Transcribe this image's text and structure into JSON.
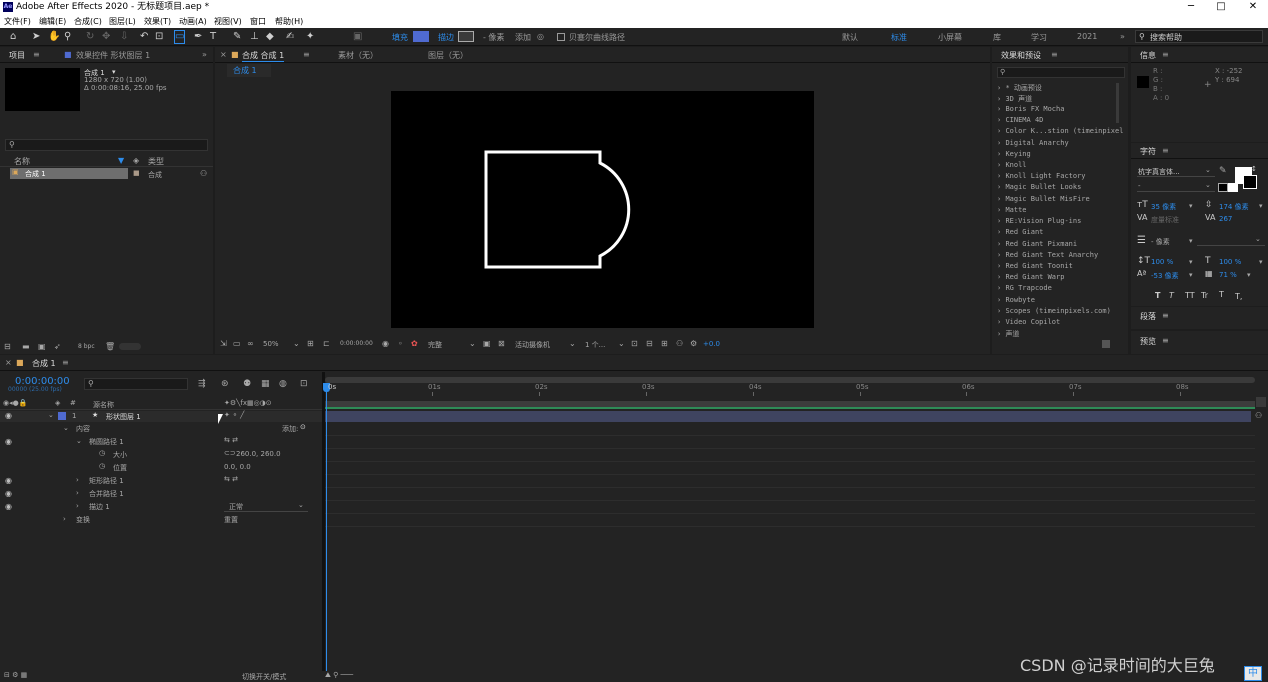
{
  "app": {
    "title": "Adobe After Effects 2020 - 无标题项目.aep *",
    "logo": "Ae"
  },
  "window_controls": {
    "min": "─",
    "max": "□",
    "close": "✕"
  },
  "menu": [
    "文件(F)",
    "编辑(E)",
    "合成(C)",
    "图层(L)",
    "效果(T)",
    "动画(A)",
    "视图(V)",
    "窗口",
    "帮助(H)"
  ],
  "toolbar": {
    "fill_label": "填充",
    "stroke_label": "描边",
    "stroke_px": "- 像素",
    "add_label": "添加",
    "bezier_label": "贝塞尔曲线路径",
    "workspaces": [
      "默认",
      "标准",
      "小屏幕",
      "库",
      "学习",
      "2021"
    ],
    "active_workspace": "标准",
    "search_help": "搜索帮助"
  },
  "project_panel": {
    "tab": "项目",
    "tab2": "效果控件 形状图层 1",
    "comp_name": "合成 1",
    "comp_info1": "1280 x 720 (1.00)",
    "comp_info2": "Δ 0:00:08:16, 25.00 fps",
    "col_name": "名称",
    "col_type": "类型",
    "item_name": "合成 1",
    "item_type": "合成",
    "bpc": "8 bpc"
  },
  "comp_panel": {
    "tab": "合成 合成 1",
    "tab_footage": "素材（无）",
    "tab_layer": "图层（无）",
    "subtab": "合成 1",
    "zoom": "50%",
    "timecode": "0:00:00:00",
    "quality": "完整",
    "camera": "活动摄像机",
    "views": "1 个...",
    "exposure": "+0.0"
  },
  "effects_panel": {
    "title": "效果和预设",
    "items": [
      "* 动画预设",
      "3D 声道",
      "Boris FX Mocha",
      "CINEMA 4D",
      "Color K...stion (timeinpixel",
      "Digital Anarchy",
      "Keying",
      "Knoll",
      "Knoll Light Factory",
      "Magic Bullet Looks",
      "Magic Bullet MisFire",
      "Matte",
      "RE:Vision Plug-ins",
      "Red Giant",
      "Red Giant Pixmani",
      "Red Giant Text Anarchy",
      "Red Giant Toonit",
      "Red Giant Warp",
      "RG Trapcode",
      "Rowbyte",
      "Scopes (timeinpixels.com)",
      "Video Copilot",
      "声道"
    ]
  },
  "info_panel": {
    "title": "信息",
    "r": "R :",
    "g": "G :",
    "b": "B :",
    "a": "A : 0",
    "x": "X : -252",
    "y": "Y : 694"
  },
  "char_panel": {
    "title": "字符",
    "font": "杭字真言体...",
    "style": "-",
    "size": "35 像素",
    "leading": "174 像素",
    "kerning": "度量标准",
    "tracking": "267",
    "stroke": "- 像素",
    "vscale": "100 %",
    "hscale": "100 %",
    "baseline": "-53 像素",
    "tsume": "71 %",
    "styles": [
      "T",
      "T",
      "TT",
      "Tr",
      "T",
      "T,"
    ],
    "para_title": "段落",
    "preview_title": "预览"
  },
  "timeline": {
    "tab": "合成 1",
    "timecode": "0:00:00:00",
    "frame_info": "00000 (25.00 fps)",
    "col_source": "源名称",
    "ruler": [
      "0s",
      "01s",
      "02s",
      "03s",
      "04s",
      "05s",
      "06s",
      "07s",
      "08s"
    ],
    "layers": [
      {
        "num": "1",
        "name": "形状图层 1",
        "indent": 0
      },
      {
        "name": "内容",
        "indent": 1,
        "right": "添加:"
      },
      {
        "name": "椭圆路径 1",
        "indent": 2
      },
      {
        "name": "大小",
        "indent": 3,
        "value": "260.0, 260.0"
      },
      {
        "name": "位置",
        "indent": 3,
        "value": "0.0, 0.0"
      },
      {
        "name": "矩形路径 1",
        "indent": 2
      },
      {
        "name": "合并路径 1",
        "indent": 2
      },
      {
        "name": "描边 1",
        "indent": 2,
        "mode": "正常"
      },
      {
        "name": "变换",
        "indent": 1,
        "value": "重置"
      }
    ],
    "footer": "切换开关/模式"
  },
  "watermark": "CSDN @记录时间的大巨兔",
  "ime": "中",
  "colors": {
    "accent": "#2d8ceb",
    "layer_label": "#4f6ad0",
    "track": "#3f4460"
  }
}
